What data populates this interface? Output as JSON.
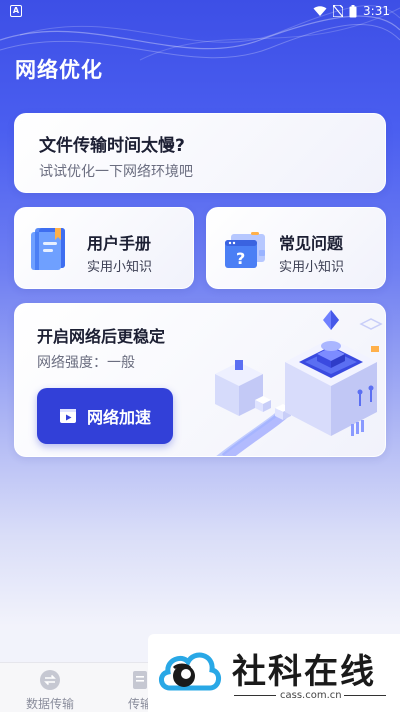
{
  "status_bar": {
    "time": "3:31",
    "left_badge": "A"
  },
  "app_title": "网络优化",
  "slow_card": {
    "title": "文件传输时间太慢?",
    "subtitle": "试试优化一下网络环境吧"
  },
  "manual_card": {
    "title": "用户手册",
    "subtitle": "实用小知识",
    "icon": "book-icon"
  },
  "faq_card": {
    "title": "常见问题",
    "subtitle": "实用小知识",
    "icon": "question-window-icon"
  },
  "network_card": {
    "title": "开启网络后更稳定",
    "strength": "网络强度：一般",
    "button_label": "网络加速"
  },
  "bottom_nav": {
    "items": [
      {
        "label": "数据传输",
        "icon": "transfer-icon"
      },
      {
        "label": "传输",
        "icon": "document-icon"
      }
    ]
  },
  "watermark": {
    "name": "社科在线",
    "url": "cass.com.cn"
  },
  "colors": {
    "primary": "#3240d8",
    "header_blue": "#3d4fe6"
  }
}
